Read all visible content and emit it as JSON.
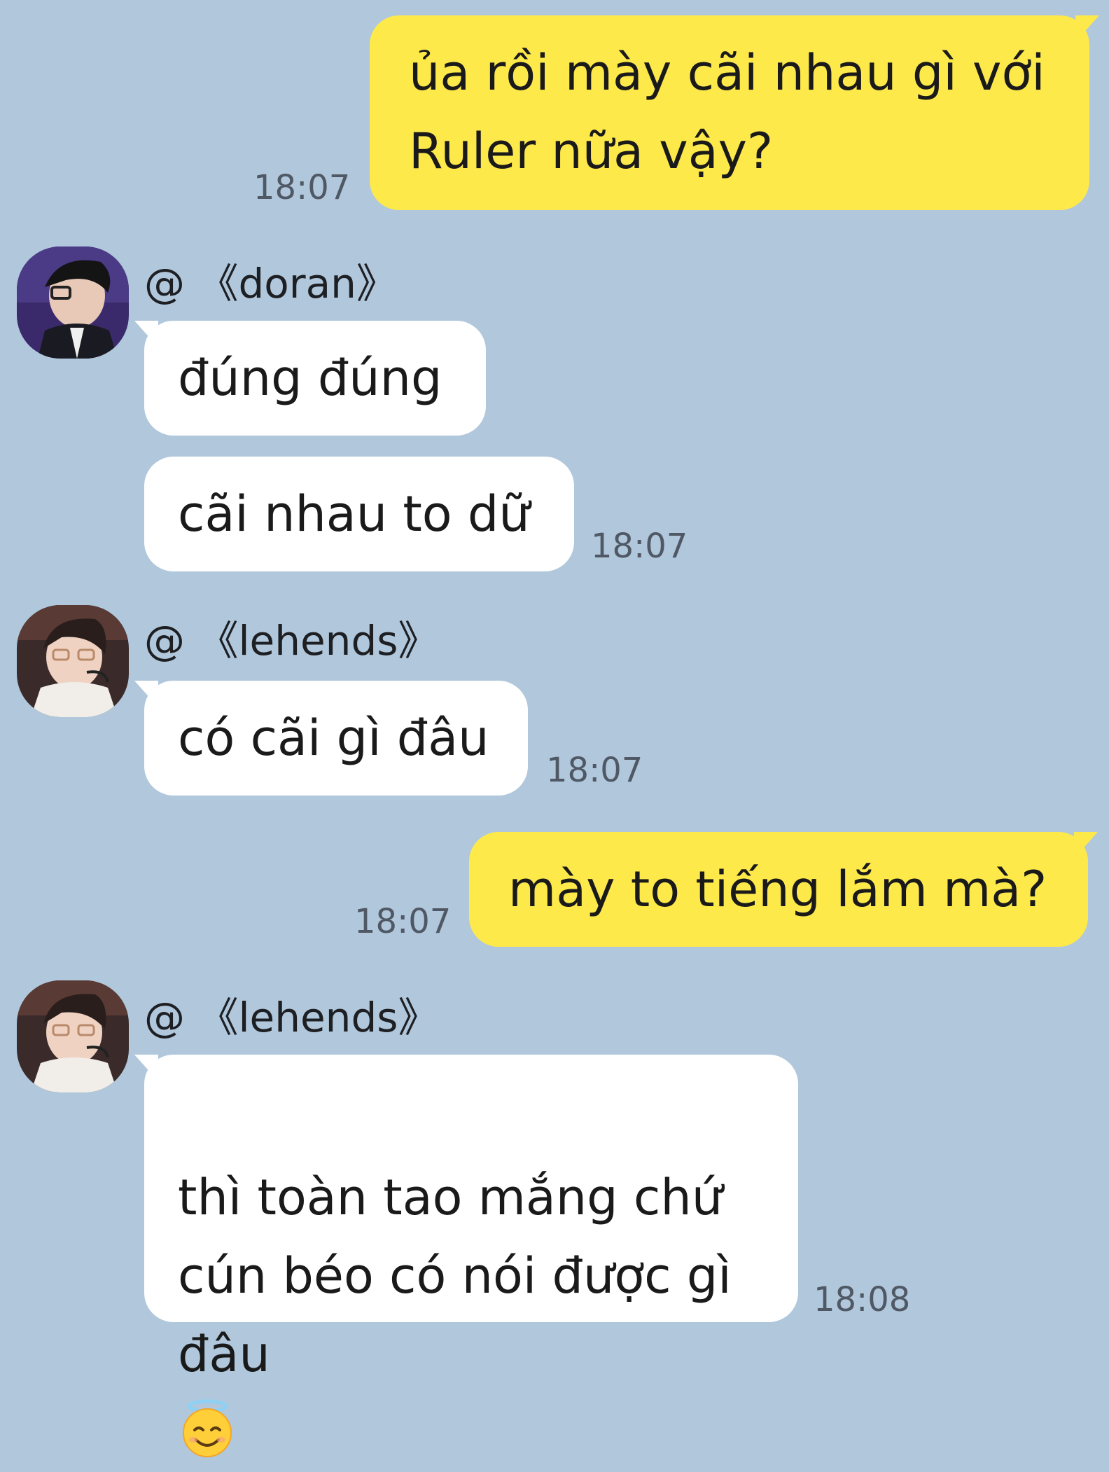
{
  "messages": [
    {
      "sender": "me",
      "text": "ủa rồi mày cãi nhau gì với\nRuler nữa vậy?",
      "time": "18:07"
    },
    {
      "sender": "《doran》",
      "name_prefix": "@",
      "texts": [
        "đúng đúng",
        "cãi nhau to dữ"
      ],
      "time": "18:07"
    },
    {
      "sender": "《lehends》",
      "name_prefix": "@",
      "texts": [
        "có cãi gì đâu"
      ],
      "time": "18:07"
    },
    {
      "sender": "me",
      "text": "mày to tiếng lắm mà?",
      "time": "18:07"
    },
    {
      "sender": "《lehends》",
      "name_prefix": "@",
      "text": "thì toàn tao mắng chứ\ncún béo có nói được gì\nđâu",
      "emoji": "smiling-face-with-halo",
      "time": "18:08"
    }
  ],
  "colors": {
    "background": "#b0c7dc",
    "outgoing_bubble": "#fee94a",
    "incoming_bubble": "#ffffff",
    "timestamp": "#4f5864"
  },
  "icons": {
    "avatar_doran": "doran-avatar",
    "avatar_lehends": "lehends-avatar",
    "emoji": "smiling-face-with-halo-icon"
  }
}
